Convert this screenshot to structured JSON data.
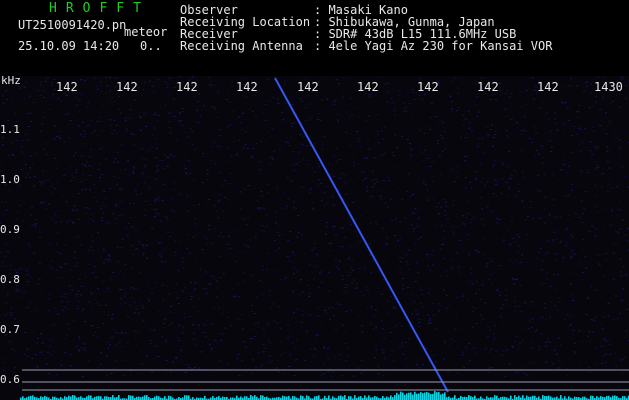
{
  "header": {
    "app_title": "HROFFT",
    "file_name": "UT2510091420.pn",
    "type": "meteor",
    "datetime": "25.10.09 14:20",
    "count": "0..",
    "info": [
      {
        "label": "Observer",
        "value": ": Masaki Kano"
      },
      {
        "label": "Receiving Location",
        "value": ": Shibukawa, Gunma, Japan"
      },
      {
        "label": "Receiver",
        "value": ": SDR# 43dB L15 111.6MHz USB"
      },
      {
        "label": "Receiving Antenna",
        "value": ": 4ele Yagi Az 230 for Kansai VOR"
      }
    ]
  },
  "spectrogram": {
    "freq_unit": "kHz",
    "y_ticks": [
      "1.1",
      "1.0",
      "0.9",
      "0.8",
      "0.7",
      "0.6"
    ],
    "x_ticks": [
      "142",
      "142",
      "142",
      "142",
      "142",
      "142",
      "142",
      "142",
      "142",
      "1430"
    ],
    "colors": {
      "background": "#06060c",
      "noise": "#1a1a66",
      "trace": "#3a5cff",
      "reference_line": "#9a9ab0",
      "audio": "#00d8e8"
    }
  }
}
